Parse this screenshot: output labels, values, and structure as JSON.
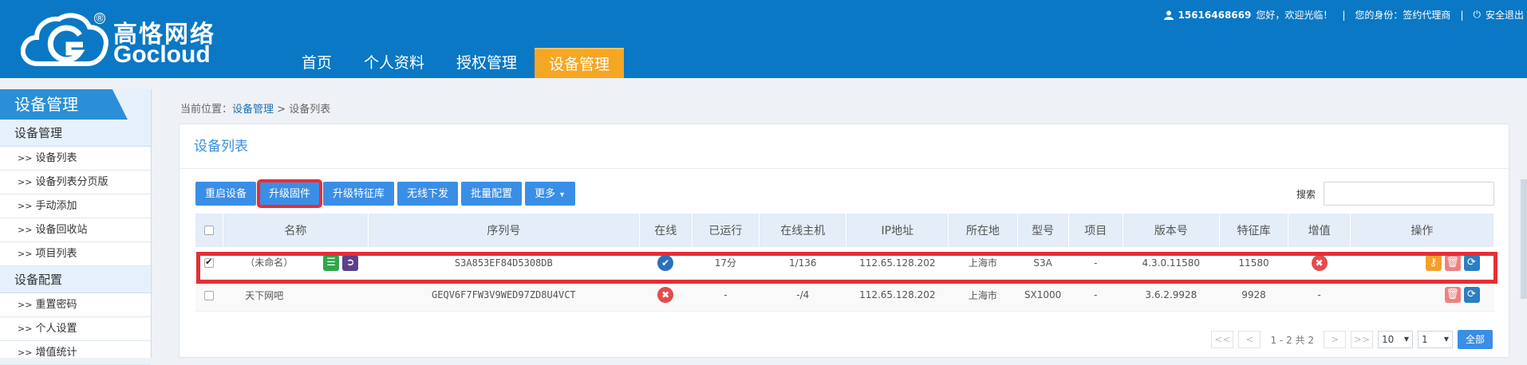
{
  "brand": {
    "name_cn": "高恪网络",
    "name_en": "Gocloud"
  },
  "nav": {
    "items": [
      "首页",
      "个人资料",
      "授权管理",
      "设备管理"
    ],
    "active": "设备管理"
  },
  "topbar": {
    "phone": "15616468669",
    "greeting": "您好，欢迎光临！",
    "role": "您的身份：签约代理商",
    "logout": "安全退出",
    "sep": "|"
  },
  "sidebar": {
    "title": "设备管理",
    "groups": [
      {
        "label": "设备管理",
        "items": [
          "设备列表",
          "设备列表分页版",
          "手动添加",
          "设备回收站",
          "项目列表"
        ]
      },
      {
        "label": "设备配置",
        "items": [
          "重置密码",
          "个人设置",
          "增值统计"
        ]
      }
    ],
    "chevron": ">>"
  },
  "breadcrumb": {
    "prefix": "当前位置：",
    "link": "设备管理",
    "sep": " > ",
    "current": "设备列表"
  },
  "panel": {
    "title": "设备列表"
  },
  "toolbar": {
    "reboot": "重启设备",
    "upgrade_fw": "升级固件",
    "upgrade_sig": "升级特征库",
    "wireless": "无线下发",
    "batch": "批量配置",
    "more": "更多"
  },
  "search": {
    "label": "搜索",
    "placeholder": ""
  },
  "table": {
    "headers": [
      "名称",
      "序列号",
      "在线",
      "已运行",
      "在线主机",
      "IP地址",
      "所在地",
      "型号",
      "项目",
      "版本号",
      "特征库",
      "增值",
      "操作"
    ],
    "rows": [
      {
        "checked": true,
        "name": "（未命名）",
        "serial": "S3A853EF84D5308DB",
        "online": true,
        "uptime": "17分",
        "hosts": "1/136",
        "ip": "112.65.128.202",
        "location": "上海市",
        "model": "S3A",
        "project": "-",
        "version": "4.3.0.11580",
        "sig": "11580",
        "vas": false
      },
      {
        "checked": false,
        "name": "天下网吧",
        "serial": "GEQV6F7FW3V9WED97ZD8U4VCT",
        "online": false,
        "uptime": "-",
        "hosts": "-/4",
        "ip": "112.65.128.202",
        "location": "上海市",
        "model": "SX1000",
        "project": "-",
        "version": "3.6.2.9928",
        "sig": "9928",
        "vas": "-"
      }
    ]
  },
  "pager": {
    "first": "<<",
    "prev": "<",
    "next": ">",
    "last": ">>",
    "info": "1 - 2 共 2",
    "page_size": "10",
    "page": "1",
    "all": "全部"
  },
  "icons": {
    "user": "user-icon",
    "power": "power-icon",
    "detail": "list-icon",
    "enter": "login-icon",
    "online": "check-circle-icon",
    "offline": "x-circle-icon",
    "key": "key-icon",
    "delete": "trash-icon",
    "refresh": "refresh-icon"
  },
  "colors": {
    "header": "#0a78c4",
    "active_nav": "#f5a623",
    "primary_button": "#3a8ee6",
    "highlight": "#e62e34"
  }
}
